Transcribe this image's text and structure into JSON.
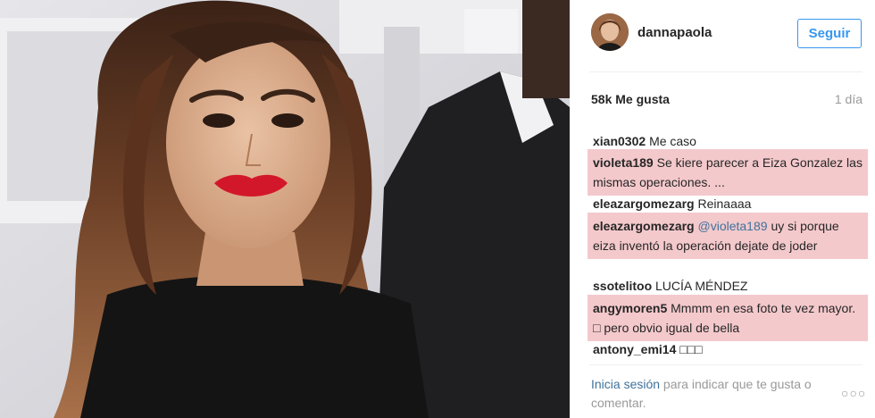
{
  "post": {
    "photo_alt": "selfie photo",
    "username": "dannapaola",
    "follow_label": "Seguir",
    "likes": "58k Me gusta",
    "time": "1 día"
  },
  "comments": [
    {
      "user": "xian0302",
      "text": "Me caso",
      "highlighted": false
    },
    {
      "user": "violeta189",
      "text": "Se kiere parecer a Eiza Gonzalez las mismas operaciones. ...",
      "highlighted": true
    },
    {
      "user": "eleazargomezarg",
      "text": "Reinaaaa",
      "highlighted": false
    },
    {
      "user": "eleazargomezarg",
      "mention": "@violeta189",
      "text": "uy si porque eiza inventó la operación dejate de joder",
      "highlighted": true
    },
    {
      "user": "ssotelitoo",
      "text": "LUCÍA MÉNDEZ",
      "highlighted": false
    },
    {
      "user": "angymoren5",
      "text": "Mmmm en esa foto te vez mayor. □ pero obvio igual de bella",
      "highlighted": true
    },
    {
      "user": "antony_emi14",
      "text": "□□□",
      "highlighted": false
    }
  ],
  "footer": {
    "login_link": "Inicia sesión",
    "login_text": " para indicar que te gusta o comentar.",
    "more_icon": "more-options-icon"
  },
  "colors": {
    "link_blue": "#3f729b",
    "follow_blue": "#3897f0",
    "highlight": "#f4c9cc",
    "muted": "#999999"
  }
}
